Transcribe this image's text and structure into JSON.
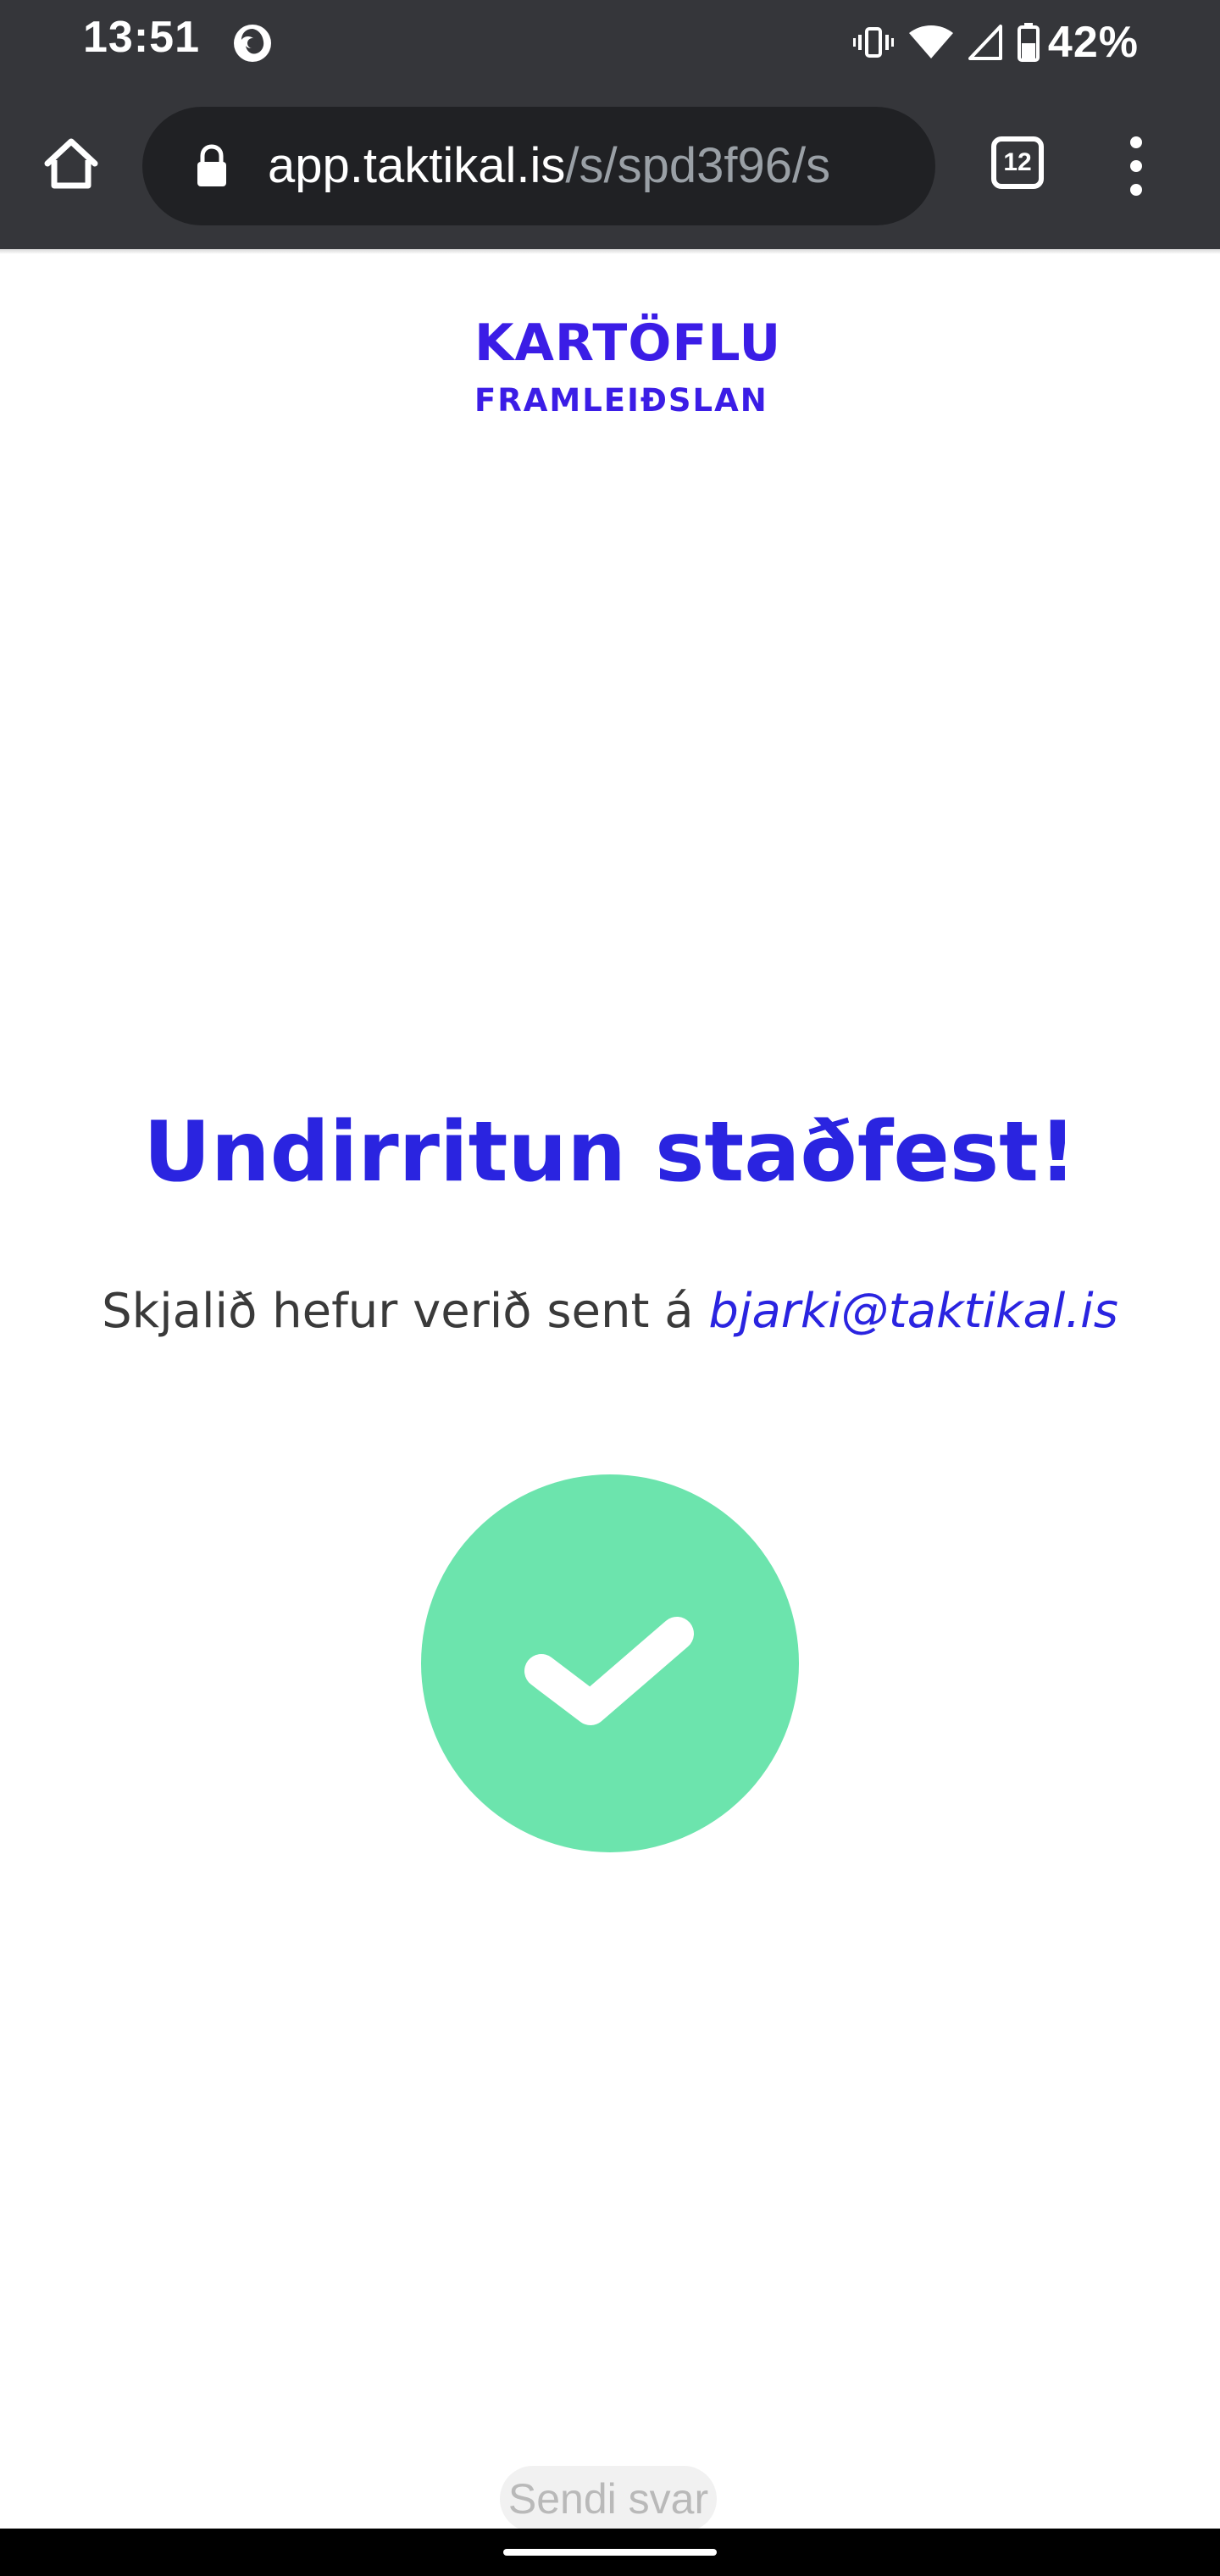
{
  "status_bar": {
    "time": "13:51",
    "battery": "42%",
    "icons": [
      "firefox-icon",
      "vibrate-icon",
      "wifi-icon",
      "cell-signal-icon",
      "battery-icon"
    ]
  },
  "browser": {
    "url_domain": "app.taktikal.is",
    "url_path": "/s/spd3f96/s",
    "tab_count": "12",
    "icons": [
      "home-icon",
      "lock-icon",
      "overflow-menu-icon"
    ]
  },
  "logo": {
    "line1": "KARTÖFLU",
    "line2": "FRAMLEIÐSLAN"
  },
  "confirmation": {
    "title": "Undirritun staðfest!",
    "message": "Skjalið hefur verið sent á",
    "email": "bjarki@taktikal.is",
    "icon": "checkmark-icon"
  },
  "actions": {
    "send_label": "Sendi svar"
  },
  "colors": {
    "brand": "#2a24e0",
    "success": "#6ce4ad",
    "chrome_bar": "#35363a"
  }
}
